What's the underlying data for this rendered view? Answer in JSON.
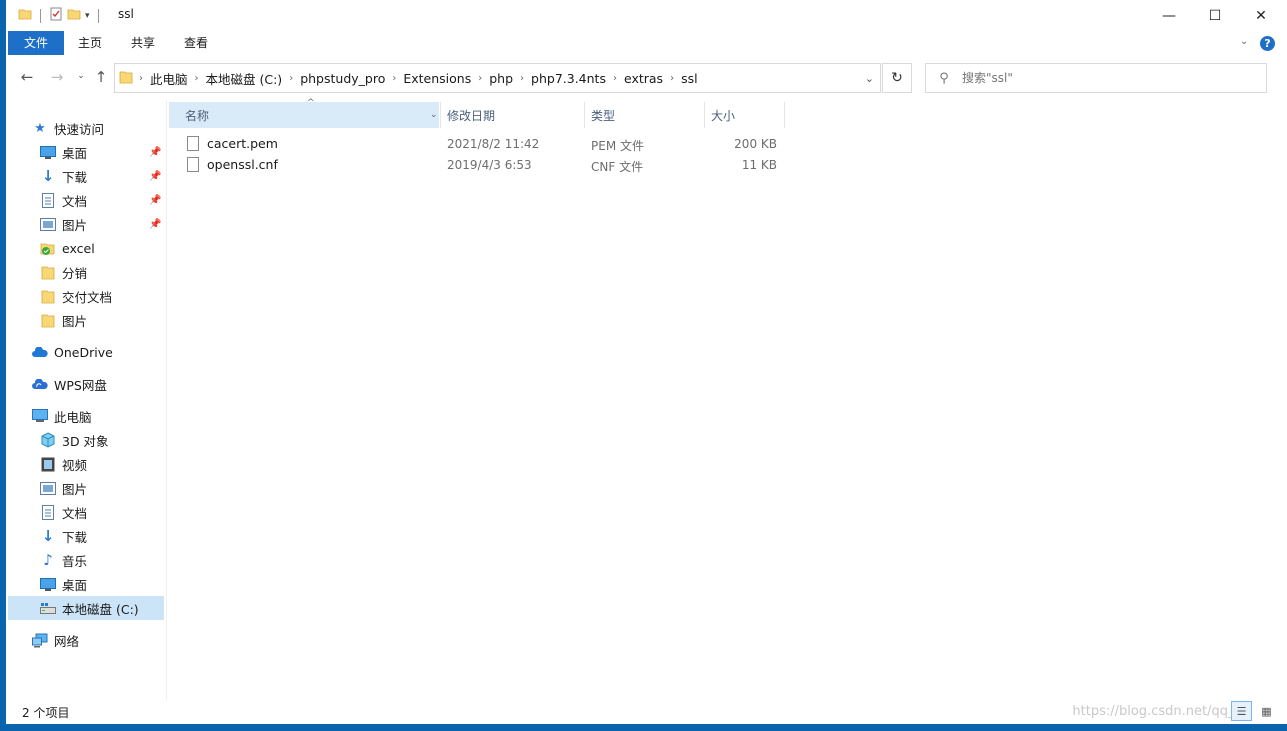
{
  "window": {
    "title": "ssl",
    "controls": {
      "minimize": "—",
      "maximize": "☐",
      "close": "✕"
    }
  },
  "ribbon": {
    "tabs": [
      {
        "label": "文件"
      },
      {
        "label": "主页"
      },
      {
        "label": "共享"
      },
      {
        "label": "查看"
      }
    ],
    "help": "?"
  },
  "address": {
    "crumbs": [
      "此电脑",
      "本地磁盘 (C:)",
      "phpstudy_pro",
      "Extensions",
      "php",
      "php7.3.4nts",
      "extras",
      "ssl"
    ]
  },
  "search": {
    "placeholder": "搜索\"ssl\""
  },
  "sidebar": {
    "quick_access": "快速访问",
    "quick_items": [
      {
        "label": "桌面",
        "pinned": true
      },
      {
        "label": "下载",
        "pinned": true
      },
      {
        "label": "文档",
        "pinned": true
      },
      {
        "label": "图片",
        "pinned": true
      },
      {
        "label": "excel",
        "pinned": false
      },
      {
        "label": "分销",
        "pinned": false
      },
      {
        "label": "交付文档",
        "pinned": false
      },
      {
        "label": "图片",
        "pinned": false
      }
    ],
    "onedrive": "OneDrive",
    "wps": "WPS网盘",
    "this_pc": "此电脑",
    "pc_items": [
      {
        "label": "3D 对象"
      },
      {
        "label": "视频"
      },
      {
        "label": "图片"
      },
      {
        "label": "文档"
      },
      {
        "label": "下载"
      },
      {
        "label": "音乐"
      },
      {
        "label": "桌面"
      },
      {
        "label": "本地磁盘 (C:)"
      }
    ],
    "network": "网络"
  },
  "columns": {
    "name": "名称",
    "modified": "修改日期",
    "type": "类型",
    "size": "大小"
  },
  "files": [
    {
      "name": "cacert.pem",
      "modified": "2021/8/2 11:42",
      "type": "PEM 文件",
      "size": "200 KB"
    },
    {
      "name": "openssl.cnf",
      "modified": "2019/4/3 6:53",
      "type": "CNF 文件",
      "size": "11 KB"
    }
  ],
  "status": {
    "item_count": "2 个项目",
    "watermark": "https://blog.csdn.net/qq_41"
  },
  "colors": {
    "accent": "#0a64ad",
    "ribbon_file_tab": "#1e6fc8",
    "selection": "#cce4f7",
    "column_header_selected": "#d9ebf9"
  }
}
